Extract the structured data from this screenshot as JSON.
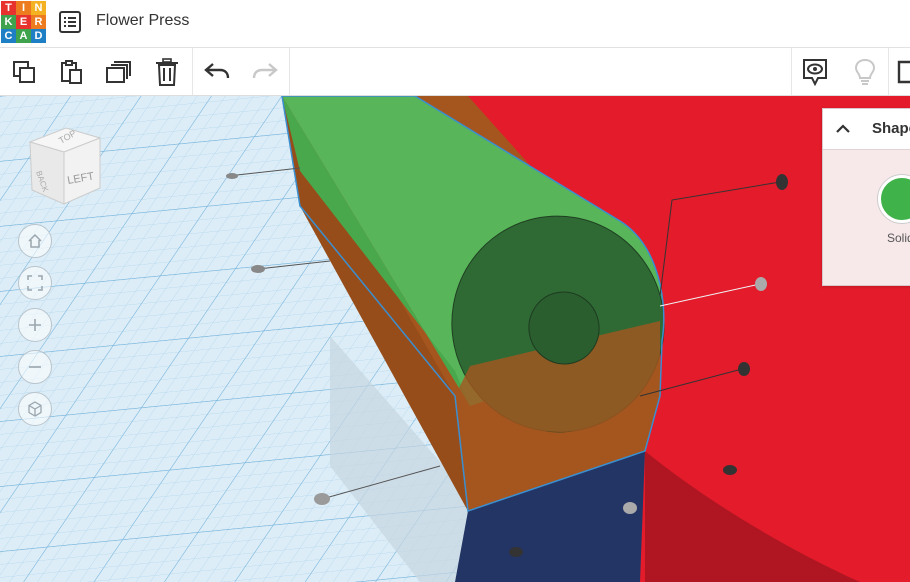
{
  "app": {
    "logo_letters": [
      "T",
      "I",
      "N",
      "K",
      "E",
      "R",
      "C",
      "A",
      "D"
    ],
    "logo_colors": [
      "#e8322d",
      "#ec7c1f",
      "#f4b223",
      "#3fa34d",
      "#e8322d",
      "#ec7c1f",
      "#1e7fc4",
      "#3fa34d",
      "#1e7fc4"
    ],
    "project_title": "Flower Press"
  },
  "toolbar": {
    "items": [
      {
        "name": "copy-icon",
        "label": "Copy"
      },
      {
        "name": "paste-icon",
        "label": "Paste"
      },
      {
        "name": "duplicate-icon",
        "label": "Duplicate"
      },
      {
        "name": "delete-icon",
        "label": "Delete"
      },
      {
        "name": "undo-icon",
        "label": "Undo"
      },
      {
        "name": "redo-icon",
        "label": "Redo"
      }
    ],
    "right_items": [
      {
        "name": "notes-icon",
        "label": "Notes"
      },
      {
        "name": "lightbulb-icon",
        "label": "Hint"
      }
    ]
  },
  "viewcube": {
    "face_label": "LEFT",
    "top_label": "TOP",
    "side_label": "BACK"
  },
  "view_controls": [
    {
      "name": "home-view-icon"
    },
    {
      "name": "fit-all-icon"
    },
    {
      "name": "zoom-in-icon"
    },
    {
      "name": "zoom-out-icon"
    },
    {
      "name": "perspective-icon"
    }
  ],
  "inspector": {
    "title": "Shape",
    "solid_label": "Solid",
    "solid_color": "#3fb24a"
  },
  "scene_colors": {
    "workplane": "#d9ecf7",
    "grid": "#9fcbe6",
    "cylinder": "#56b357",
    "box": "#a5561f",
    "wall": "#e31b2b",
    "base": "#233565",
    "selection": "#3b8fd0"
  }
}
